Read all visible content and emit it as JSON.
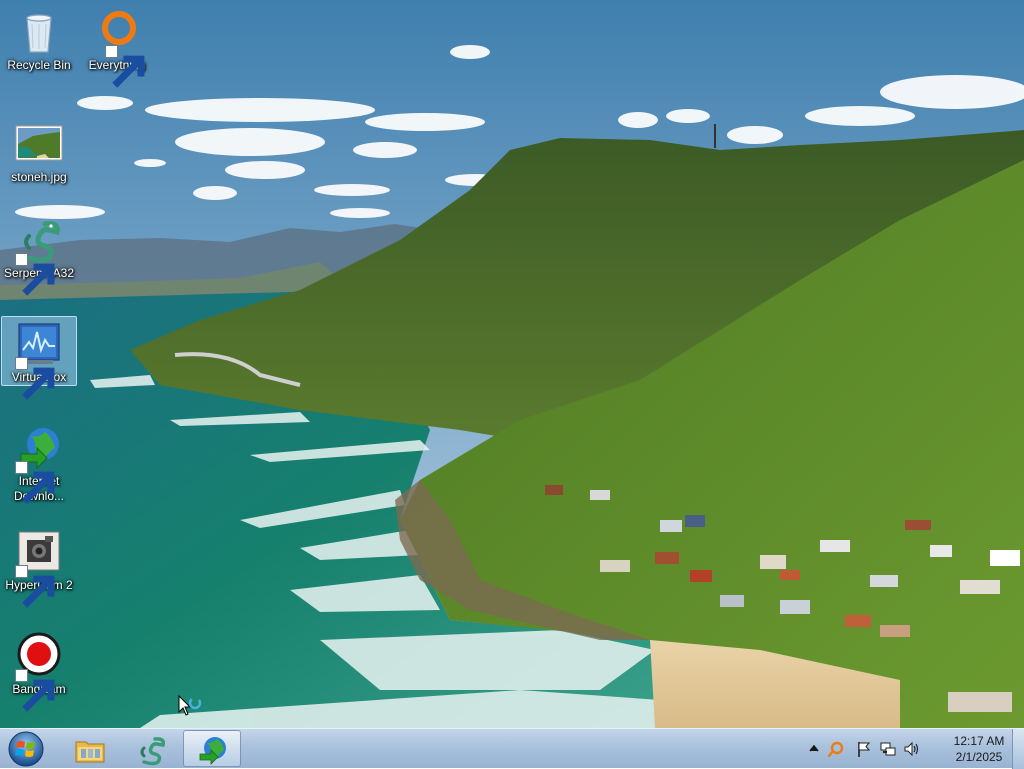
{
  "desktop": {
    "icons": [
      {
        "label": "Recycle Bin",
        "icon": "recycle-bin-icon",
        "shortcut": false
      },
      {
        "label": "Everything",
        "icon": "everything-search-icon",
        "shortcut": true
      },
      {
        "label": "stoneh.jpg",
        "icon": "image-file-icon",
        "shortcut": false
      },
      {
        "label": "Serpent IA32",
        "icon": "serpent-icon",
        "shortcut": true
      },
      {
        "label": "VirtualBox",
        "icon": "virtualbox-icon",
        "shortcut": true,
        "selected": true
      },
      {
        "label": "Internet Downlo...",
        "icon": "internet-download-manager-icon",
        "shortcut": true
      },
      {
        "label": "HyperCam 2",
        "icon": "hypercam-icon",
        "shortcut": true
      },
      {
        "label": "Bandicam",
        "icon": "bandicam-icon",
        "shortcut": true
      }
    ]
  },
  "taskbar": {
    "start": {
      "icon": "windows-start-orb-icon"
    },
    "pinned": [
      {
        "icon": "file-explorer-icon",
        "active": false
      },
      {
        "icon": "serpent-icon",
        "active": false
      },
      {
        "icon": "internet-download-manager-icon",
        "active": true
      }
    ],
    "tray": {
      "icons": [
        "show-hidden-icons-chevron-icon",
        "everything-tray-icon",
        "action-center-flag-icon",
        "network-icon",
        "volume-icon"
      ],
      "time": "12:17 AM",
      "date": "2/1/2025"
    }
  },
  "colors": {
    "taskbar": "#a9c1dc",
    "selection": "#a0c8f0",
    "bandicam_red": "#e01010",
    "everything_orange": "#f07a12"
  }
}
